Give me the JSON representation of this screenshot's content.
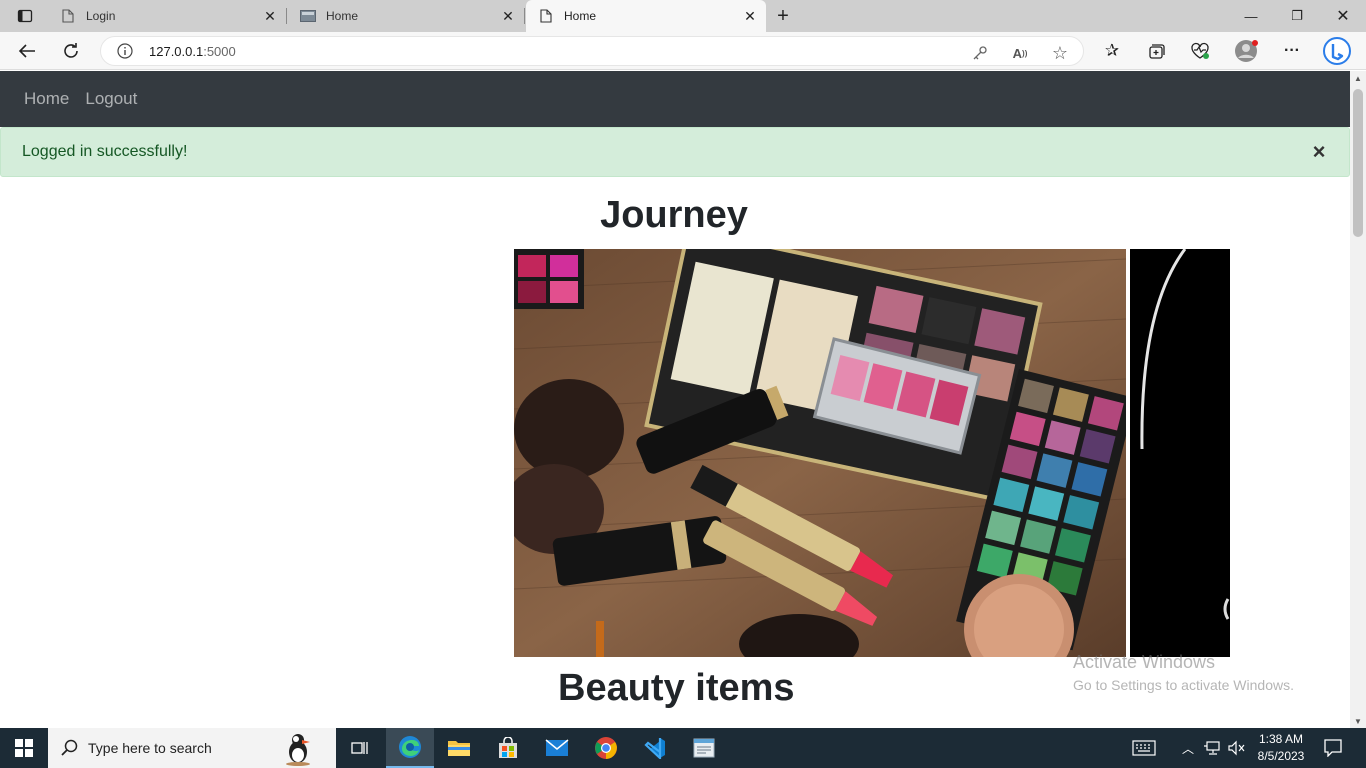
{
  "browser": {
    "tabs": [
      {
        "label": "Login",
        "icon": "page-icon",
        "active": false
      },
      {
        "label": "Home",
        "icon": "image-tab-icon",
        "active": false
      },
      {
        "label": "Home",
        "icon": "page-icon",
        "active": true
      }
    ],
    "address": {
      "host": "127.0.0.1",
      "port": ":5000"
    }
  },
  "page": {
    "nav": {
      "home": "Home",
      "logout": "Logout"
    },
    "flash": {
      "message": "Logged in successfully!",
      "close": "×"
    },
    "section1_title": "Journey",
    "section2_title": "Beauty items",
    "carousel": {
      "slides": [
        "makeup-flatlay-image",
        "dark-slide-image"
      ]
    }
  },
  "watermark": {
    "line1": "Activate Windows",
    "line2": "Go to Settings to activate Windows."
  },
  "taskbar": {
    "search_placeholder": "Type here to search",
    "time": "1:38 AM",
    "date": "8/5/2023"
  },
  "colors": {
    "navbar": "#343a40",
    "alert_bg": "#d4edda",
    "alert_text": "#155724",
    "taskbar": "#1c2b36"
  }
}
